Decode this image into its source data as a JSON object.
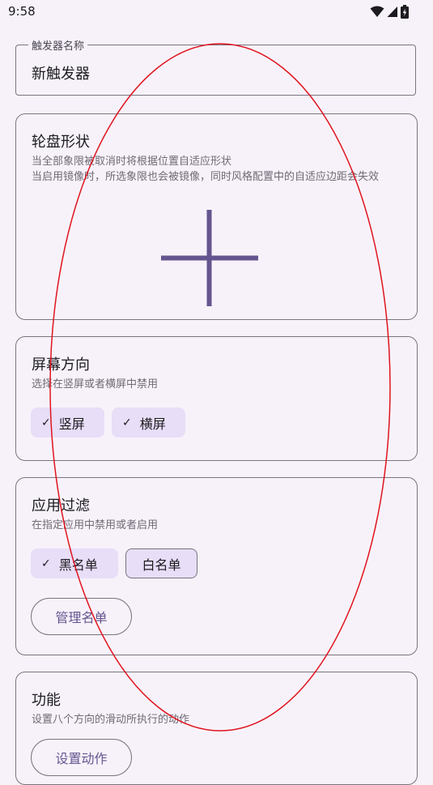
{
  "status_bar": {
    "time": "9:58",
    "icons": [
      "wifi-icon",
      "cellular-signal-icon",
      "battery-charging-icon"
    ]
  },
  "trigger_name": {
    "label": "触发器名称",
    "value": "新触发器"
  },
  "wheel_shape": {
    "title": "轮盘形状",
    "description_1": "当全部象限被取消时将根据位置自适应形状",
    "description_2": "当启用镜像时，所选象限也会被镜像，同时风格配置中的自适应边距会失效",
    "icon": "cross-shape-icon"
  },
  "screen_orientation": {
    "title": "屏幕方向",
    "description": "选择在竖屏或者横屏中禁用",
    "chips": [
      {
        "label": "竖屏",
        "selected": true
      },
      {
        "label": "横屏",
        "selected": true
      }
    ]
  },
  "app_filter": {
    "title": "应用过滤",
    "description": "在指定应用中禁用或者启用",
    "chips": [
      {
        "label": "黑名单",
        "selected": true
      },
      {
        "label": "白名单",
        "selected": false
      }
    ],
    "manage_button": "管理名单"
  },
  "function": {
    "title": "功能",
    "description": "设置八个方向的滑动所执行的动作",
    "action_button": "设置动作"
  },
  "colors": {
    "accent": "#65558f",
    "chip_bg": "#e8def8",
    "outline": "#79747e",
    "background": "#f7f2fa",
    "annotation": "#e0141e"
  }
}
